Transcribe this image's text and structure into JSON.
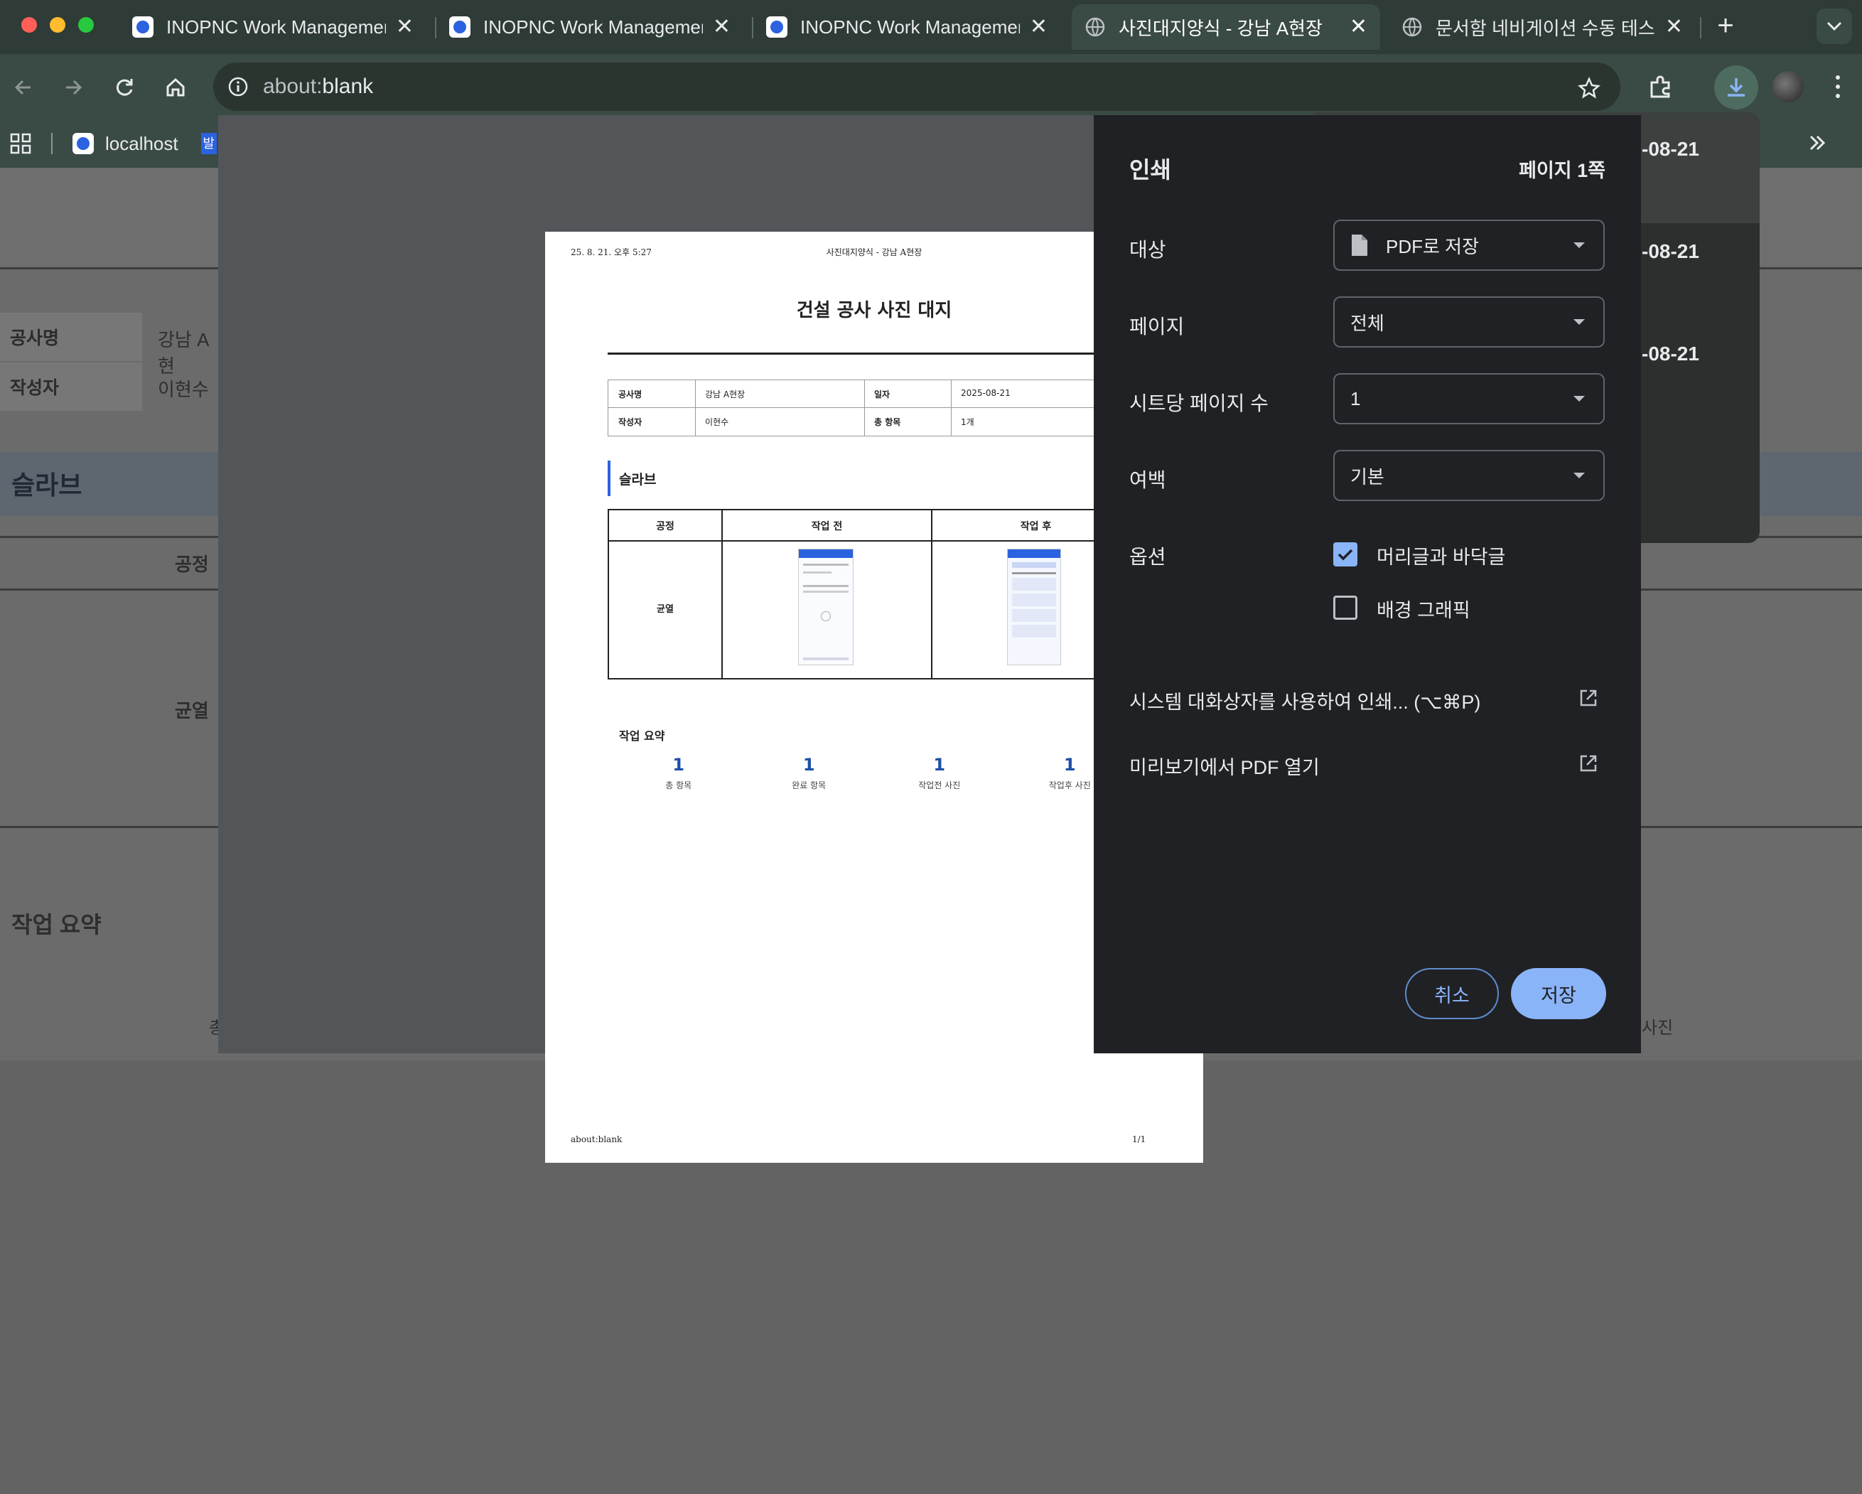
{
  "tabs": [
    {
      "title": "INOPNC Work Management"
    },
    {
      "title": "INOPNC Work Management"
    },
    {
      "title": "INOPNC Work Management"
    },
    {
      "title": "사진대지양식 - 강남 A현장"
    },
    {
      "title": "문서함 네비게이션 수동 테스트"
    }
  ],
  "new_tab_label": "+",
  "address": {
    "scheme": "about:",
    "rest": "blank"
  },
  "bookmarks": {
    "item1": "localhost",
    "item2": "발"
  },
  "background_page": {
    "row1_label": "공사명",
    "row1_value": "강남 A현",
    "row2_label": "작성자",
    "row2_value": "이현수",
    "section_title": "슬라브",
    "col_process": "공정",
    "process_value": "균열",
    "summary_title": "작업 요약",
    "summary_partial_left": "총",
    "summary_partial_right": "사진"
  },
  "downloads": {
    "items": [
      "-08-21",
      "-08-21",
      "-08-21"
    ]
  },
  "preview": {
    "header_left": "25. 8. 21. 오후 5:27",
    "header_center": "사진대지양식 - 강남 A현장",
    "doc_title": "건설 공사 사진 대지",
    "info": {
      "project_label": "공사명",
      "project_value": "강남 A현장",
      "date_label": "일자",
      "date_value": "2025-08-21",
      "author_label": "작성자",
      "author_value": "이현수",
      "total_label": "총 항목",
      "total_value": "1개"
    },
    "section_title": "슬라브",
    "table": {
      "col1": "공정",
      "col2": "작업 전",
      "col3": "작업 후",
      "process": "균열"
    },
    "summary": {
      "title": "작업 요약",
      "stats": [
        {
          "value": "1",
          "label": "총 항목"
        },
        {
          "value": "1",
          "label": "완료 항목"
        },
        {
          "value": "1",
          "label": "작업전 사진"
        },
        {
          "value": "1",
          "label": "작업후 사진"
        }
      ]
    },
    "footer_left": "about:blank",
    "footer_right": "1/1"
  },
  "print_panel": {
    "title": "인쇄",
    "page_count": "페이지 1쪽",
    "destination_label": "대상",
    "destination_value": "PDF로 저장",
    "pages_label": "페이지",
    "pages_value": "전체",
    "per_sheet_label": "시트당 페이지 수",
    "per_sheet_value": "1",
    "margins_label": "여백",
    "margins_value": "기본",
    "options_label": "옵션",
    "opt_headers": "머리글과 바닥글",
    "opt_headers_checked": true,
    "opt_background": "배경 그래픽",
    "opt_background_checked": false,
    "system_dialog": "시스템 대화상자를 사용하여 인쇄... (⌥⌘P)",
    "open_preview": "미리보기에서 PDF 열기",
    "cancel": "취소",
    "save": "저장"
  },
  "colors": {
    "accent": "#8ab4f8",
    "brand_blue": "#2b62e0"
  }
}
